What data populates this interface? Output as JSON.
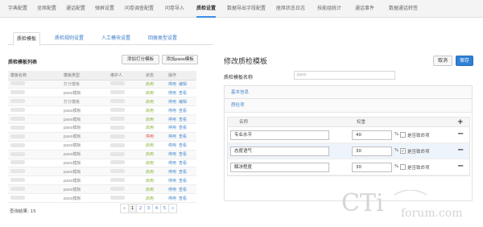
{
  "topnav": [
    "字典配置",
    "坐席配置",
    "通话配置",
    "弹屏设置",
    "问卷调查配置",
    "问卷导入",
    "质检设置",
    "数据导出字段配置",
    "座席状态日志",
    "技能组统计",
    "通话事件",
    "数据通话转签"
  ],
  "subtabs": [
    "质检模板",
    "质检规则设置",
    "人工模块设置",
    "回拨类型设置"
  ],
  "list": {
    "title": "质检模板列表",
    "add_score_button": "添加打分模板",
    "add_pass_button": "添加pass模板",
    "columns": [
      "模板名称",
      "模板类型",
      "维护人",
      "状态",
      "操作"
    ],
    "rows": [
      {
        "type": "打分模板",
        "status": "启用",
        "status_kind": "on",
        "op1": "停用",
        "op2": "编辑"
      },
      {
        "type": "pass模板",
        "status": "启用",
        "status_kind": "on",
        "op1": "停用",
        "op2": "查看"
      },
      {
        "type": "打分模板",
        "status": "启用",
        "status_kind": "on",
        "op1": "停用",
        "op2": "编辑"
      },
      {
        "type": "pass模板",
        "status": "启用",
        "status_kind": "on",
        "op1": "停用",
        "op2": "查看"
      },
      {
        "type": "pass模板",
        "status": "启用",
        "status_kind": "on",
        "op1": "停用",
        "op2": "查看"
      },
      {
        "type": "pass模板",
        "status": "启用",
        "status_kind": "on",
        "op1": "停用",
        "op2": "查看"
      },
      {
        "type": "pass模板",
        "status": "停用",
        "status_kind": "off",
        "op1": "停用",
        "op2": "查看"
      },
      {
        "type": "pass模板",
        "status": "启用",
        "status_kind": "on",
        "op1": "停用",
        "op2": "查看"
      },
      {
        "type": "pass模板",
        "status": "启用",
        "status_kind": "on",
        "op1": "停用",
        "op2": "查看"
      },
      {
        "type": "pass模板",
        "status": "启用",
        "status_kind": "on",
        "op1": "停用",
        "op2": "查看"
      },
      {
        "type": "pass模板",
        "status": "启用",
        "status_kind": "on",
        "op1": "停用",
        "op2": "查看"
      },
      {
        "type": "pass模板",
        "status": "启用",
        "status_kind": "on",
        "op1": "停用",
        "op2": "查看"
      },
      {
        "type": "pass模板",
        "status": "启用",
        "status_kind": "on",
        "op1": "停用",
        "op2": "查看"
      },
      {
        "type": "pass模板",
        "status": "启用",
        "status_kind": "on",
        "op1": "停用",
        "op2": "查看"
      }
    ],
    "result_label": "查询结果: 15",
    "pages": [
      "«",
      "1",
      "2",
      "3",
      "4",
      "5",
      "»"
    ],
    "active_page": "1"
  },
  "form": {
    "title": "修改质检模板",
    "cancel_button": "取消",
    "save_button": "保存",
    "name_label": "质检模板名称",
    "name_value": "pass",
    "basic_info": "基本信息",
    "items_section": "质检项",
    "col_name": "名称",
    "col_weight": "权重",
    "add_icon": "+",
    "items": [
      {
        "name": "专业水平",
        "weight": "40",
        "percent": "%",
        "checked": false,
        "veto_label": "是否致命项",
        "remove_icon": "−"
      },
      {
        "name": "态度语气",
        "weight": "30",
        "percent": "%",
        "checked": true,
        "veto_label": "是否致命项",
        "remove_icon": "−"
      },
      {
        "name": "解决程度",
        "weight": "30",
        "percent": "%",
        "checked": false,
        "veto_label": "是否致命项",
        "remove_icon": "−"
      }
    ]
  },
  "watermark": {
    "logo_main": "CTi",
    "logo_sub": "forum.com"
  },
  "colors": {
    "accent": "#2f7fd4",
    "link": "#4a8ad0",
    "enabled": "#8ab43c",
    "disabled": "#e05252"
  }
}
